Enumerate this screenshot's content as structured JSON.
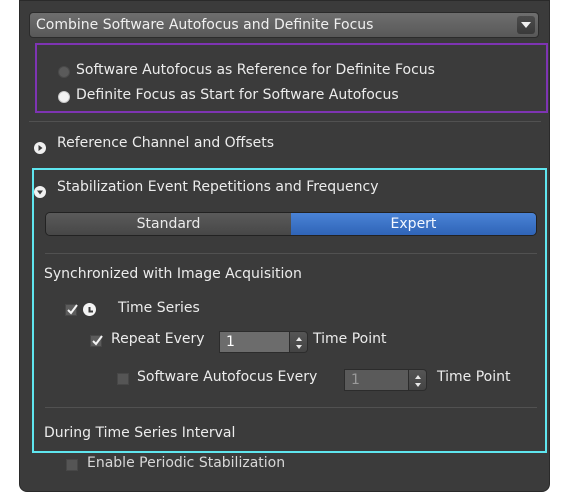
{
  "combo": {
    "value": "Combine Software Autofocus and Definite Focus"
  },
  "reference_mode": {
    "options": [
      {
        "label": "Software Autofocus as Reference for Definite Focus",
        "selected": false
      },
      {
        "label": "Definite Focus as Start for Software Autofocus",
        "selected": true
      }
    ]
  },
  "reference_section": {
    "title": "Reference Channel and Offsets",
    "expanded": false
  },
  "stabilization_section": {
    "title": "Stabilization Event Repetitions and Frequency",
    "expanded": true
  },
  "mode_toggle": {
    "standard_label": "Standard",
    "expert_label": "Expert",
    "active": "Expert"
  },
  "sync": {
    "heading": "Synchronized with Image Acquisition",
    "time_series_label": "Time Series",
    "time_series_checked": true,
    "repeat_every_label": "Repeat Every",
    "repeat_every_value": "1",
    "repeat_unit_label": "Time Point",
    "repeat_checked": true,
    "software_af_label": "Software Autofocus Every",
    "software_af_value": "1",
    "software_af_unit_label": "Time Point",
    "software_af_checked": false
  },
  "interval": {
    "heading": "During Time Series Interval",
    "periodic_label": "Enable Periodic Stabilization",
    "periodic_checked": false
  },
  "colors": {
    "panel_bg": "#3b3b3b",
    "accent_blue": "#3a70c4",
    "annotation_purple": "#7e34b3",
    "annotation_cyan": "#5fe6ef"
  }
}
